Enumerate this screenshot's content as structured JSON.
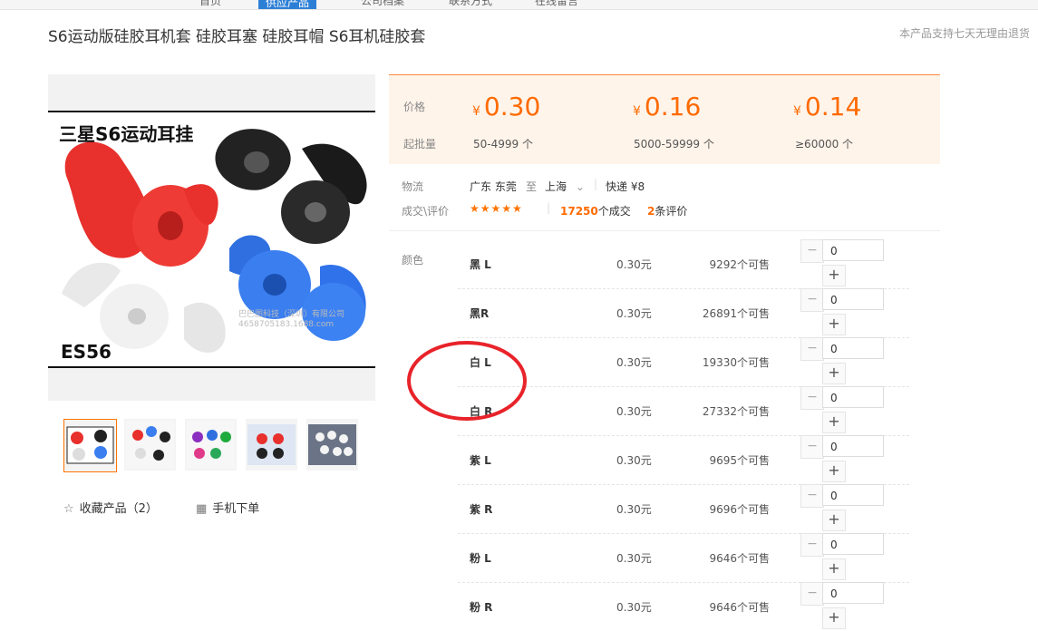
{
  "nav": {
    "items": [
      "首页",
      "供应产品",
      "公司档案",
      "联系方式",
      "在线留言"
    ]
  },
  "product": {
    "title": "S6运动版硅胶耳机套 硅胶耳塞 硅胶耳帽 S6耳机硅胶套",
    "return_tip": "本产品支持七天无理由退货",
    "image_caption_top": "三星S6运动耳挂",
    "image_caption_bottom": "ES56",
    "image_watermark_1": "巴巴图科技（深圳）有限公司",
    "image_watermark_2": "4658705183.1688.com"
  },
  "price": {
    "price_label": "价格",
    "moq_label": "起批量",
    "currency": "¥",
    "tiers": [
      {
        "price": "0.30",
        "range": "50-4999 个"
      },
      {
        "price": "0.16",
        "range": "5000-59999 个"
      },
      {
        "price": "0.14",
        "range": "≥60000 个"
      }
    ]
  },
  "logistics": {
    "label": "物流",
    "from": "广东 东莞",
    "to_word": "至",
    "to": "上海",
    "shipping": "快递 ¥8"
  },
  "review": {
    "label": "成交\\评价",
    "stars": "★★★★★",
    "deals_count": "17250",
    "deals_suffix": "个成交",
    "reviews_count": "2",
    "reviews_suffix": "条评价"
  },
  "colors": {
    "label": "颜色",
    "minus": "−",
    "plus": "+",
    "rows": [
      {
        "name": "黑 L",
        "price": "0.30元",
        "stock": "9292个可售",
        "qty": "0"
      },
      {
        "name": "黑R",
        "price": "0.30元",
        "stock": "26891个可售",
        "qty": "0"
      },
      {
        "name": "白 L",
        "price": "0.30元",
        "stock": "19330个可售",
        "qty": "0"
      },
      {
        "name": "白 R",
        "price": "0.30元",
        "stock": "27332个可售",
        "qty": "0"
      },
      {
        "name": "紫 L",
        "price": "0.30元",
        "stock": "9695个可售",
        "qty": "0"
      },
      {
        "name": "紫 R",
        "price": "0.30元",
        "stock": "9696个可售",
        "qty": "0"
      },
      {
        "name": "粉 L",
        "price": "0.30元",
        "stock": "9646个可售",
        "qty": "0"
      },
      {
        "name": "粉 R",
        "price": "0.30元",
        "stock": "9646个可售",
        "qty": "0"
      }
    ]
  },
  "actions": {
    "favorite": "收藏产品（2）",
    "mobile_order": "手机下单"
  },
  "colors_hex": {
    "accent": "#ff6a00",
    "annotation": "#e8232a",
    "nav_active": "#2d7fd6"
  }
}
